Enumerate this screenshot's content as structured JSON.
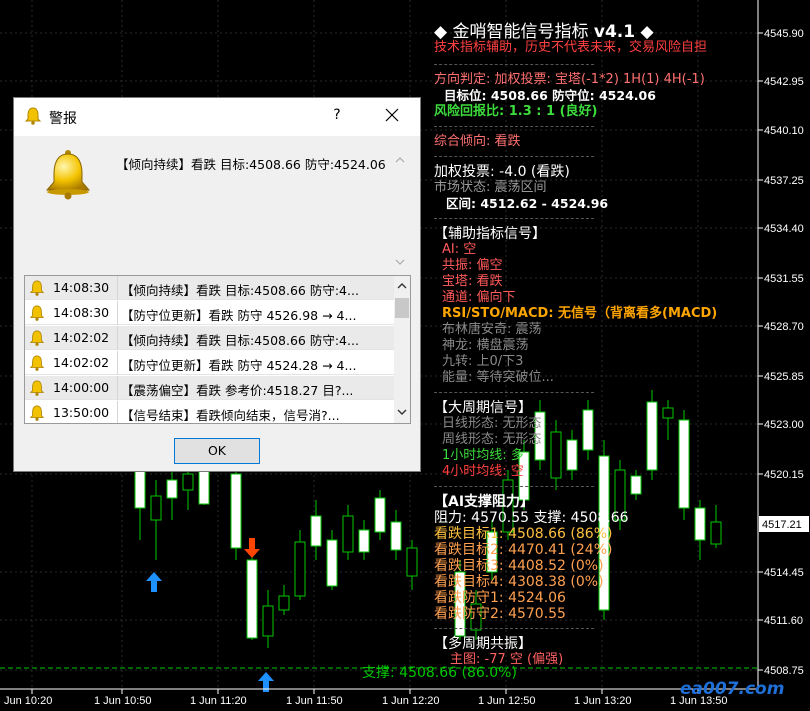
{
  "chart": {
    "price_ticks": [
      "4545.90",
      "4542.95",
      "4540.10",
      "4537.25",
      "4534.40",
      "4531.55",
      "4528.70",
      "4525.85",
      "4523.00",
      "4520.15",
      "4514.45",
      "4511.60",
      "4508.75"
    ],
    "current_price": "4517.21",
    "time_ticks": [
      "Jun 10:20",
      "1 Jun 10:50",
      "1 Jun 11:20",
      "1 Jun 11:50",
      "1 Jun 12:20",
      "1 Jun 12:50",
      "1 Jun 13:20",
      "1 Jun 13:50"
    ],
    "support_label": "支撑: 4508.66 (86.0%)",
    "watermark": "ea007.com",
    "colors": {
      "bull": "#ffffff",
      "bear": "#000000",
      "wick": "#00c800",
      "up_arrow": "#1e90ff",
      "down_arrow": "#ff4500",
      "support": "#00c800"
    }
  },
  "panel": {
    "title": "金哨智能信号指标",
    "version": "v4.1",
    "title_diamond": "◆",
    "disclaimer": "技术指标辅助，历史不代表未来，交易风险自担",
    "direction": "方向判定: 加权投票: 宝塔(-1*2) 1H(1) 4H(-1)",
    "target_stop": "目标位: 4508.66  防守位: 4524.06",
    "risk_reward": "风险回报比: 1.3 : 1 (良好)",
    "overall": "综合倾向: 看跌",
    "weighted_vote": "加权投票: -4.0 (看跌)",
    "market_state": "市场状态: 震荡区间",
    "range": "区间: 4512.62 - 4524.96",
    "aux_header": "【辅助指标信号】",
    "ai": "AI: 空",
    "resonance": "共振: 偏空",
    "baota": "宝塔: 看跌",
    "channel": "通道: 偏向下",
    "rsi": "RSI/STO/MACD: 无信号（背离看多(MACD)",
    "bollinger": "布林唐安奇: 震荡",
    "shenlong": "神龙: 横盘震荡",
    "nine_turn": "九转: 上0/下3",
    "energy": "能量: 等待突破位...",
    "big_header": "【大周期信号】",
    "daily": "日线形态: 无形态",
    "weekly": "周线形态: 无形态",
    "h1_ma": "1小时均线: 多",
    "h4_ma": "4小时均线: 空",
    "ai_sr_header": "【AI支撑阻力】",
    "res_sup": "阻力: 4570.55  支撑: 4508.66",
    "bear_t1": "看跌目标1: 4508.66 (86%)",
    "bear_t2": "看跌目标2: 4470.41 (24%)",
    "bear_t3": "看跌目标3: 4408.52 (0%)",
    "bear_t4": "看跌目标4: 4308.38 (0%)",
    "bear_s1": "看跌防守1: 4524.06",
    "bear_s2": "看跌防守2: 4570.55",
    "multi_header": "【多周期共振】",
    "multi_line": "主图: -77 空 (偏强)"
  },
  "dialog": {
    "title": "警报",
    "help": "?",
    "message": "【倾向持续】看跌 目标:4508.66 防守:4524.06",
    "rows": [
      {
        "time": "14:08:30",
        "msg": "【倾向持续】看跌 目标:4508.66 防守:4..."
      },
      {
        "time": "14:08:30",
        "msg": "【防守位更新】看跌 防守 4526.98 → 4..."
      },
      {
        "time": "14:02:02",
        "msg": "【倾向持续】看跌 目标:4508.66 防守:4..."
      },
      {
        "time": "14:02:02",
        "msg": "【防守位更新】看跌 防守 4524.28 → 4..."
      },
      {
        "time": "14:00:00",
        "msg": "【震荡偏空】看跌 参考价:4518.27 目?..."
      },
      {
        "time": "13:50:00",
        "msg": "【信号结束】看跌倾向结束，信号消?..."
      }
    ],
    "ok": "OK",
    "icons": {
      "bell": "bell-icon",
      "close": "close-icon"
    }
  }
}
